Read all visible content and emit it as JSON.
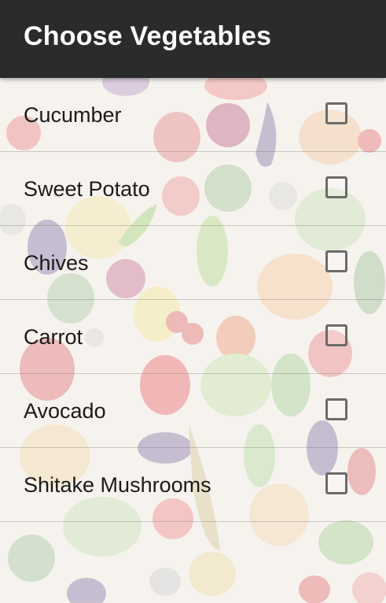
{
  "app_bar": {
    "title": "Choose Vegetables"
  },
  "vegetables": [
    {
      "label": "Cucumber",
      "checked": false
    },
    {
      "label": "Sweet Potato",
      "checked": false
    },
    {
      "label": "Chives",
      "checked": false
    },
    {
      "label": "Carrot",
      "checked": false
    },
    {
      "label": "Avocado",
      "checked": false
    },
    {
      "label": "Shitake Mushrooms",
      "checked": false
    }
  ],
  "colors": {
    "app_bar_background": "#2b2b2b",
    "title_text": "#ffffff",
    "item_text": "#1a1a1a",
    "checkbox_border": "#6b6b6b"
  }
}
